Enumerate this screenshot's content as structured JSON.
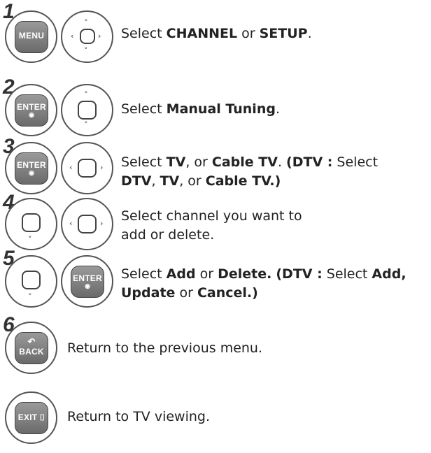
{
  "steps": [
    {
      "number": "1",
      "keys": [
        "MENU"
      ],
      "text_parts": [
        "Select ",
        "CHANNEL",
        " or ",
        "SETUP",
        "."
      ]
    },
    {
      "number": "2",
      "keys": [
        "ENTER"
      ],
      "text_parts": [
        "Select ",
        "Manual Tuning",
        "."
      ]
    },
    {
      "number": "3",
      "keys": [
        "ENTER"
      ],
      "text_parts": [
        "Select ",
        "TV",
        ", or ",
        "Cable TV",
        ". ",
        "(DTV :",
        " Select ",
        "DTV",
        ", ",
        "TV",
        ", or ",
        "Cable TV.)"
      ]
    },
    {
      "number": "4",
      "keys": [],
      "text_parts": [
        "Select channel you want to add or delete."
      ]
    },
    {
      "number": "5",
      "keys": [
        "ENTER"
      ],
      "text_parts": [
        "Select ",
        "Add",
        " or ",
        "Delete.",
        "(DTV :",
        " Select ",
        "Add,",
        "Update",
        " or ",
        "Cancel.)"
      ]
    },
    {
      "number": "6",
      "keys": [
        "BACK"
      ],
      "text_parts": [
        "Return to the previous menu."
      ]
    },
    {
      "number": "",
      "keys": [
        "EXIT"
      ],
      "text_parts": [
        "Return to TV viewing."
      ]
    }
  ],
  "glyphs": {
    "up": "˄",
    "down": "˅",
    "left": "‹",
    "right": "›",
    "dot": "◉",
    "back_icon": "↶",
    "exit_icon": "⌷"
  }
}
